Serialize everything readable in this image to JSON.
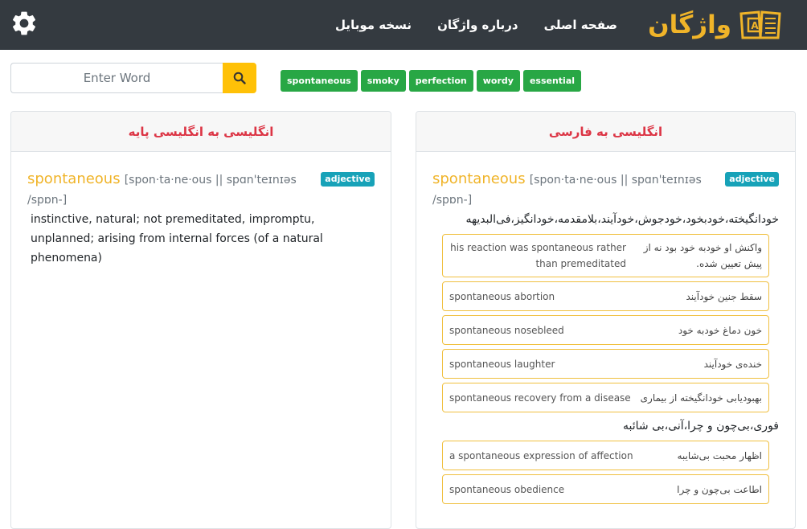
{
  "nav": {
    "brand": "واژگان",
    "links": [
      "صفحه اصلی",
      "درباره واژگان",
      "نسخه موبایل"
    ]
  },
  "search": {
    "placeholder": "Enter Word"
  },
  "tags": [
    "spontaneous",
    "smoky",
    "perfection",
    "wordy",
    "essential"
  ],
  "left_card": {
    "title": "انگلیسی به انگلیسی پایه",
    "word": "spontaneous",
    "pron": "[spon·ta·ne·ous || spɑn'teɪnɪəs /spɒn-]",
    "pos": "adjective",
    "definition": "instinctive, natural; not premeditated, impromptu, unplanned; arising from internal forces (of a natural phenomena)"
  },
  "right_card": {
    "title": "انگلیسی به فارسی",
    "word": "spontaneous",
    "pron": "[spon·ta·ne·ous || spɑn'teɪnɪəs /spɒn-]",
    "pos": "adjective",
    "meaning1": "خودانگیخته،خودبخود،خودجوش،خودآیند،بلامقدمه،خودانگیز،فی‌البدیهه",
    "examples1": [
      {
        "en": "his reaction was spontaneous rather than premeditated",
        "fa": "واکنش او خودبه خود بود نه از پیش تعیین شده."
      },
      {
        "en": "spontaneous abortion",
        "fa": "سقط جنین خودآیند"
      },
      {
        "en": "spontaneous nosebleed",
        "fa": "خون دماغ خودبه خود"
      },
      {
        "en": "spontaneous laughter",
        "fa": "خنده‌ی خودآیند"
      },
      {
        "en": "spontaneous recovery from a disease",
        "fa": "بهبودیابی خودانگیخته از بیماری"
      }
    ],
    "meaning2": "فوری،بی‌چون و چرا،آنی،بی شائبه",
    "examples2": [
      {
        "en": "a spontaneous expression of affection",
        "fa": "اظهار محبت بی‌شایبه"
      },
      {
        "en": "spontaneous obedience",
        "fa": "اطاعت بی‌چون و چرا"
      }
    ]
  },
  "colors": {
    "navbar": "#343a40",
    "brand": "#f0b429",
    "tag": "#28a745",
    "badge": "#17a2b8",
    "header_text": "#dc3545",
    "search_btn": "#ffc107"
  },
  "icons": {
    "settings": "gear-icon",
    "search": "search-icon",
    "logo": "book-logo-icon"
  }
}
